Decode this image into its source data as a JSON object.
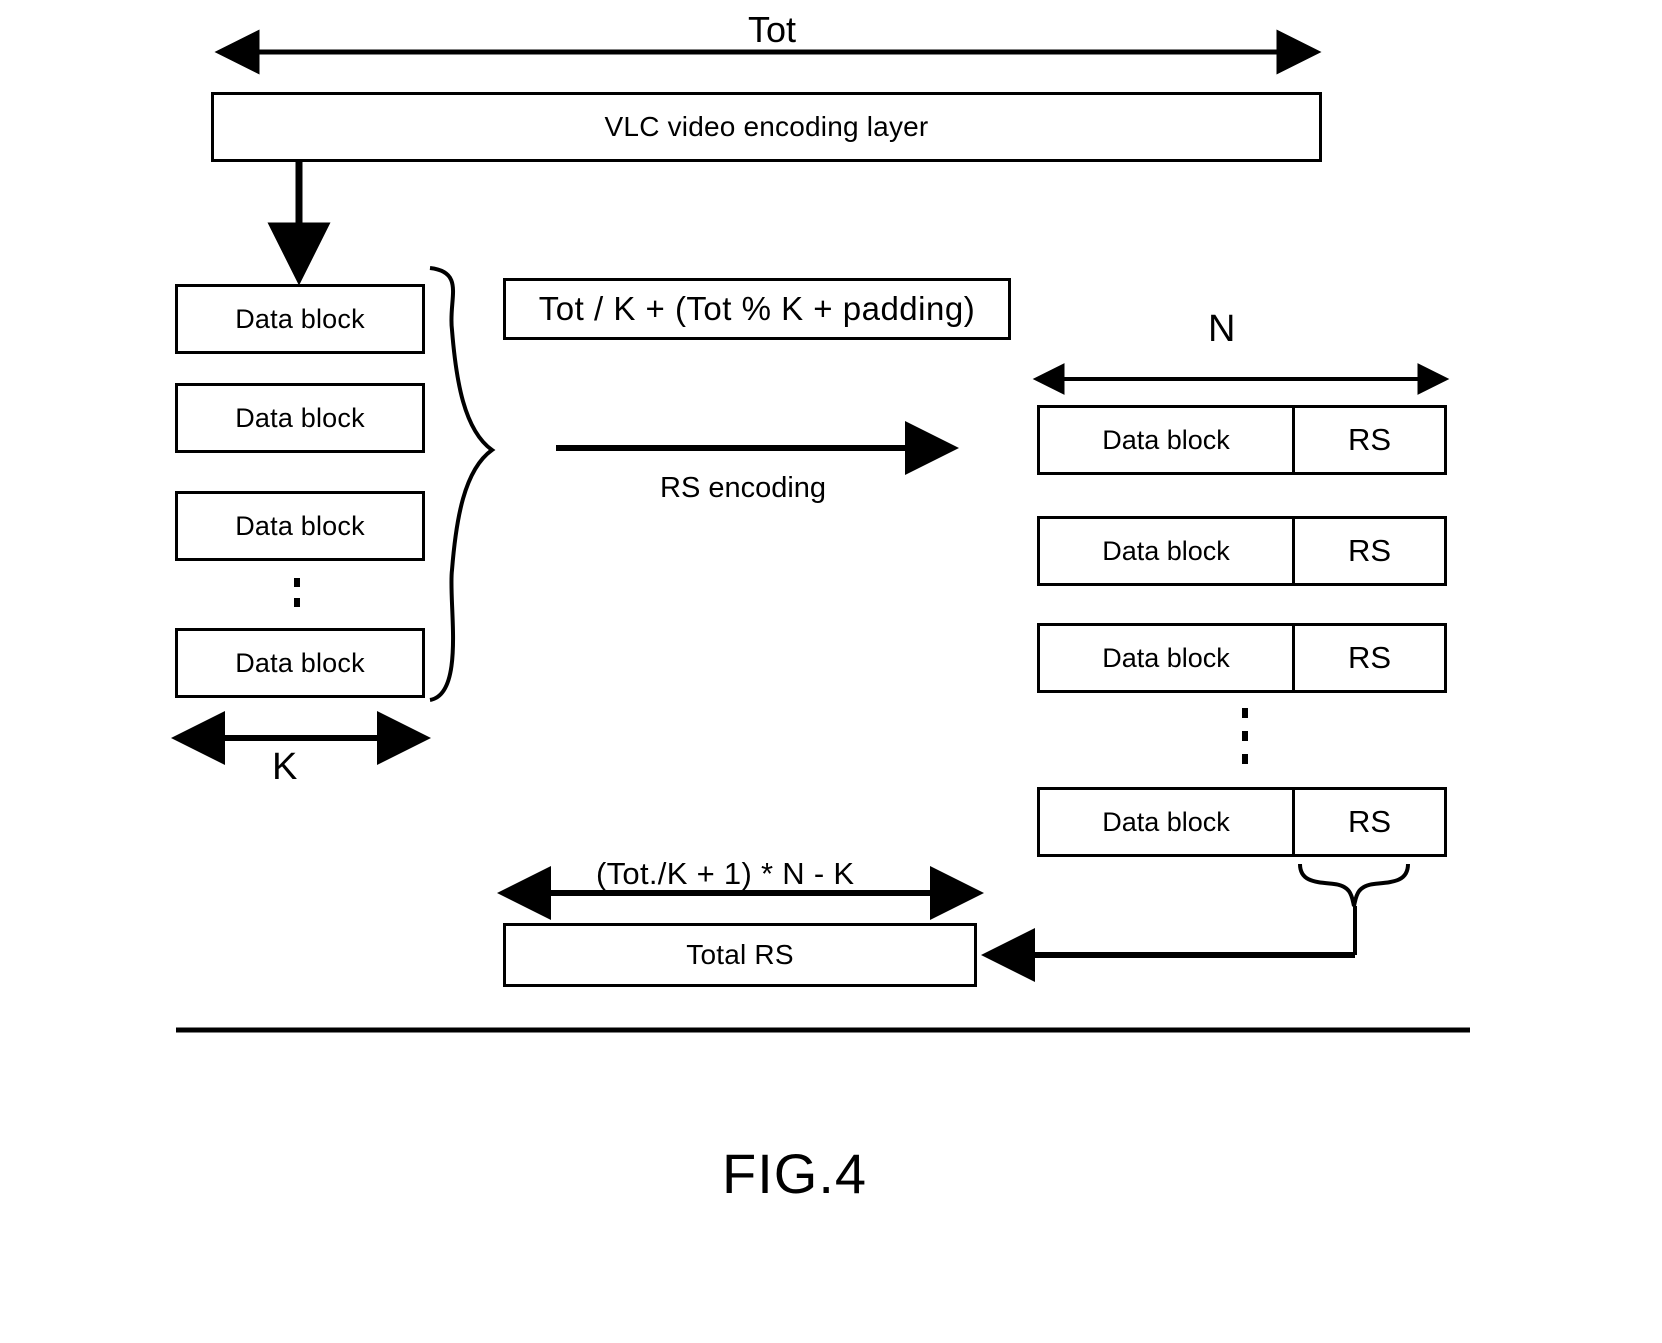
{
  "figure": {
    "caption": "FIG.4",
    "top_dimension_label": "Tot",
    "left_dimension_label": "K",
    "right_dimension_label": "N",
    "process_label": "RS encoding",
    "block_formula": "Tot / K + (Tot % K + padding)",
    "total_formula": "(Tot./K + 1) * N - K",
    "header_box_label": "VLC video encoding layer",
    "total_box_label": "Total RS",
    "left_blocks": [
      {
        "label": "Data block"
      },
      {
        "label": "Data block"
      },
      {
        "label": "Data block"
      },
      {
        "label": "Data block"
      }
    ],
    "code_rows": [
      {
        "data_label": "Data block",
        "rs_label": "RS"
      },
      {
        "data_label": "Data block",
        "rs_label": "RS"
      },
      {
        "data_label": "Data block",
        "rs_label": "RS"
      },
      {
        "data_label": "Data block",
        "rs_label": "RS"
      }
    ],
    "colors": {
      "ink": "#000000",
      "paper": "#ffffff"
    }
  }
}
